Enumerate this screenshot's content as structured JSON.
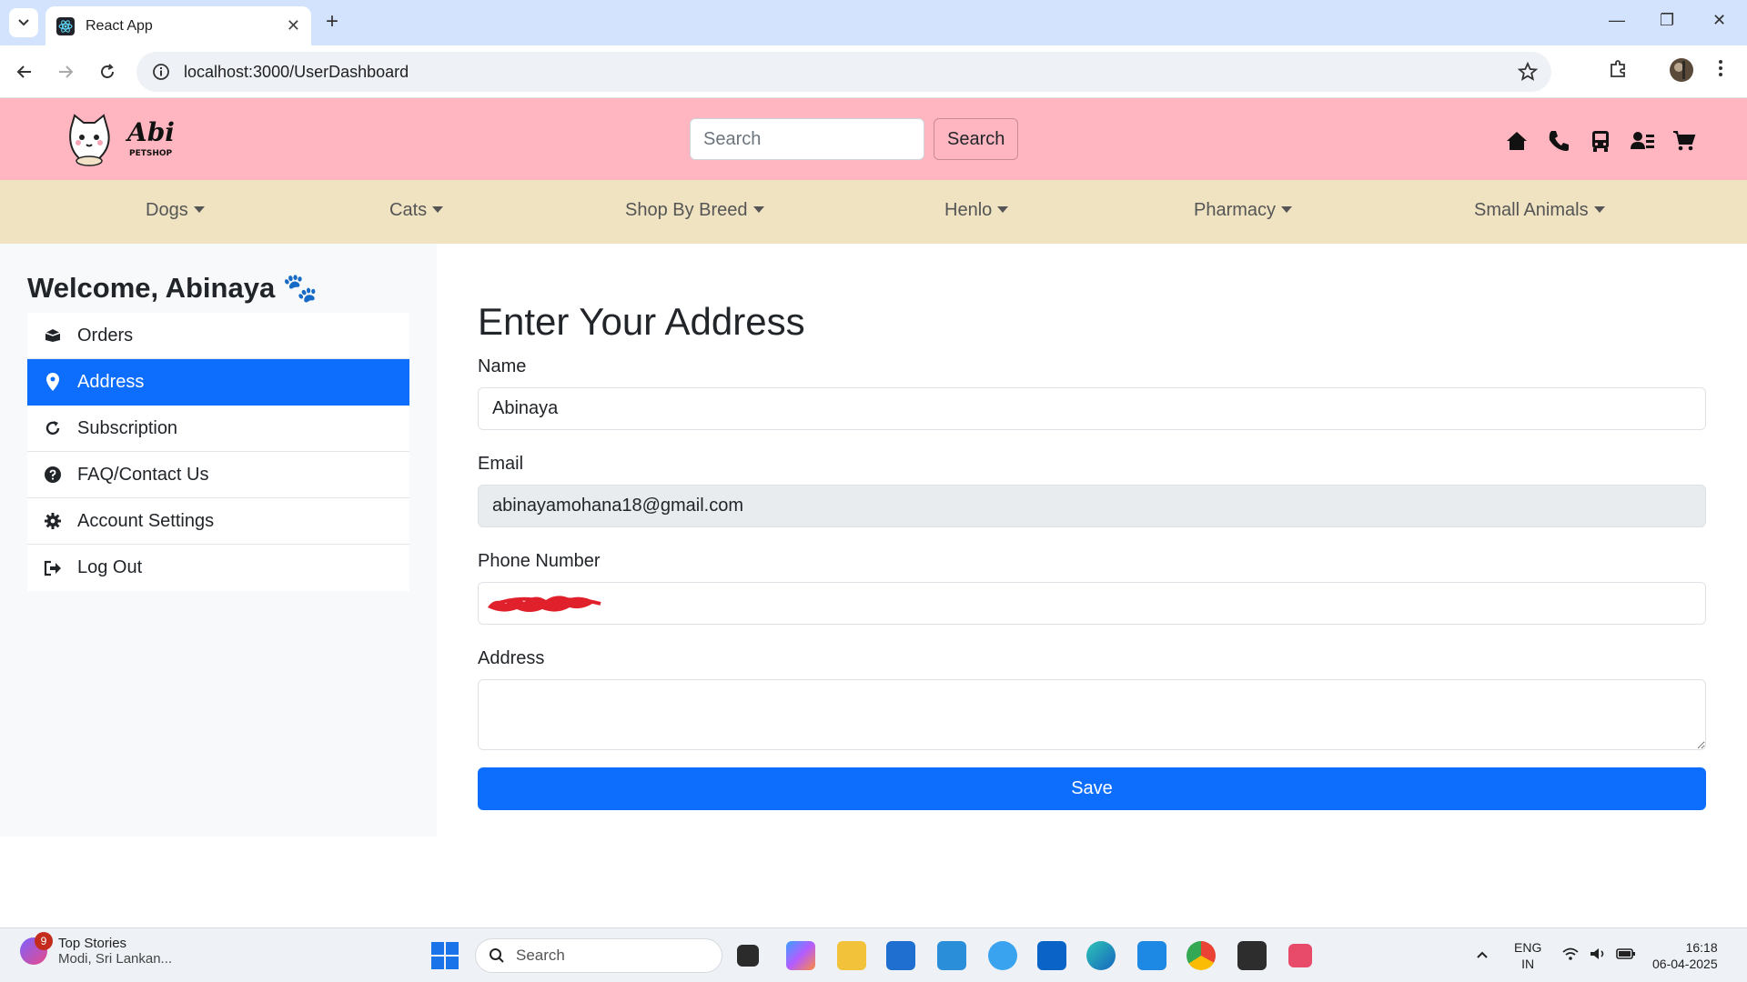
{
  "browser": {
    "tab_title": "React App",
    "url": "localhost:3000/UserDashboard",
    "tab_close": "✕",
    "new_tab": "+",
    "minimize": "—",
    "restore": "❐",
    "close": "✕"
  },
  "header": {
    "logo_text": "Abi",
    "logo_sub": "PETSHOP",
    "search_placeholder": "Search",
    "search_button": "Search",
    "icons": [
      "home-icon",
      "phone-icon",
      "bus-icon",
      "user-list-icon",
      "cart-icon"
    ]
  },
  "categories": [
    {
      "label": "Dogs"
    },
    {
      "label": "Cats"
    },
    {
      "label": "Shop By Breed"
    },
    {
      "label": "Henlo"
    },
    {
      "label": "Pharmacy"
    },
    {
      "label": "Small Animals"
    }
  ],
  "sidebar": {
    "welcome": "Welcome, Abinaya 🐾",
    "items": [
      {
        "label": "Orders",
        "icon": "box-icon",
        "active": false
      },
      {
        "label": "Address",
        "icon": "map-pin-icon",
        "active": true
      },
      {
        "label": "Subscription",
        "icon": "refresh-icon",
        "active": false
      },
      {
        "label": "FAQ/Contact Us",
        "icon": "question-icon",
        "active": false
      },
      {
        "label": "Account Settings",
        "icon": "gear-icon",
        "active": false
      },
      {
        "label": "Log Out",
        "icon": "logout-icon",
        "active": false
      }
    ]
  },
  "form": {
    "title": "Enter Your Address",
    "name_label": "Name",
    "name_value": "Abinaya",
    "email_label": "Email",
    "email_value": "abinayamohana18@gmail.com",
    "phone_label": "Phone Number",
    "address_label": "Address",
    "address_value": "",
    "save_label": "Save"
  },
  "taskbar": {
    "news_badge": "9",
    "news_title": "Top Stories",
    "news_sub": "Modi, Sri Lankan...",
    "search_placeholder": "Search",
    "lang": "ENG",
    "region": "IN",
    "time": "16:18",
    "date": "06-04-2025"
  },
  "colors": {
    "header_bg": "#ffb6c1",
    "nav_bg": "#efe3c1",
    "accent": "#0d6efd",
    "sidebar_bg": "#f8f9fa"
  }
}
